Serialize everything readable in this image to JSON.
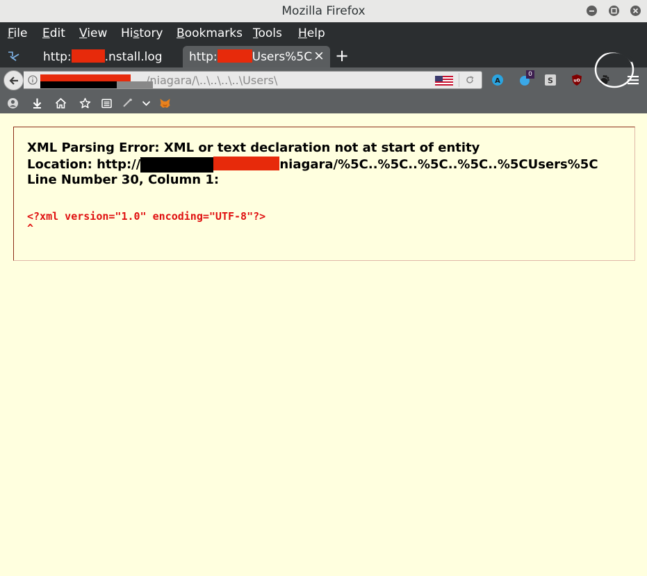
{
  "window": {
    "title": "Mozilla Firefox"
  },
  "menu": {
    "file": {
      "accel": "F",
      "rest": "ile"
    },
    "edit": {
      "accel": "E",
      "rest": "dit"
    },
    "view": {
      "accel": "V",
      "rest": "iew"
    },
    "history": {
      "pre": "Hi",
      "accel": "s",
      "rest": "tory"
    },
    "bookmarks": {
      "accel": "B",
      "rest": "ookmarks"
    },
    "tools": {
      "accel": "T",
      "rest": "ools"
    },
    "help": {
      "accel": "H",
      "rest": "elp"
    }
  },
  "tabs": [
    {
      "prefix": "http:",
      "suffix": ".nstall.log"
    },
    {
      "prefix": "http:",
      "suffix": "Users%5C",
      "close": "×"
    }
  ],
  "tab_close_glyph": "×",
  "new_tab_glyph": "+",
  "urlbar": {
    "visible_url": "/niagara/\\..\\..\\..\\..\\Users\\"
  },
  "extensions": {
    "badge_count": "0"
  },
  "error": {
    "title": "XML Parsing Error: XML or text declaration not at start of entity",
    "location_prefix": "Location: http://",
    "location_suffix": "niagara/%5C..%5C..%5C..%5C..%5CUsers%5C",
    "line_info": "Line Number 30, Column 1:",
    "source_line": "<?xml version=\"1.0\" encoding=\"UTF-8\"?>",
    "caret": "^"
  },
  "colors": {
    "page_background": "#ffffdf",
    "error_source_red": "#e01010",
    "redaction_red": "#e72a0b",
    "toolbar_dark": "#2b2e30",
    "toolbar_gray": "#5d6062"
  }
}
